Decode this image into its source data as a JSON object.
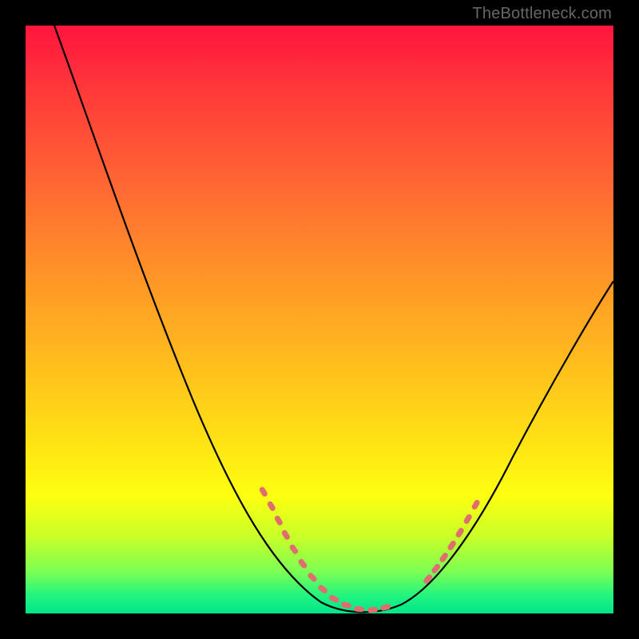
{
  "watermark": "TheBottleneck.com",
  "chart_data": {
    "type": "line",
    "title": "",
    "xlabel": "",
    "ylabel": "",
    "xlim": [
      0,
      100
    ],
    "ylim": [
      0,
      100
    ],
    "background_gradient": {
      "top": "#ff153d",
      "bottom": "#00e58b"
    },
    "series": [
      {
        "name": "bottleneck-curve",
        "color": "#000000",
        "x": [
          5,
          10,
          15,
          20,
          25,
          30,
          35,
          40,
          45,
          48,
          52,
          55,
          58,
          60,
          63,
          66,
          70,
          75,
          80,
          85,
          90,
          95,
          100
        ],
        "y": [
          100,
          90,
          79,
          67,
          55,
          43,
          32,
          21,
          11,
          6,
          2,
          0.5,
          0,
          0,
          1,
          3,
          7,
          13,
          21,
          30,
          39,
          48,
          56
        ]
      }
    ],
    "markers": [
      {
        "name": "data-point-cluster-left",
        "color": "#e07070",
        "shape": "pill",
        "x": [
          40,
          41.5,
          43,
          44.5,
          46,
          48,
          50,
          52,
          54,
          56,
          58,
          60,
          62
        ],
        "y": [
          21,
          18,
          15,
          12.5,
          10,
          7,
          4.5,
          2.5,
          1.3,
          0.6,
          0.3,
          0.3,
          0.8
        ]
      },
      {
        "name": "data-point-cluster-right",
        "color": "#e07070",
        "shape": "pill",
        "x": [
          68,
          69.5,
          71,
          72.5,
          74,
          75.5,
          77
        ],
        "y": [
          5,
          7,
          9,
          11,
          13,
          15,
          17
        ]
      }
    ]
  }
}
